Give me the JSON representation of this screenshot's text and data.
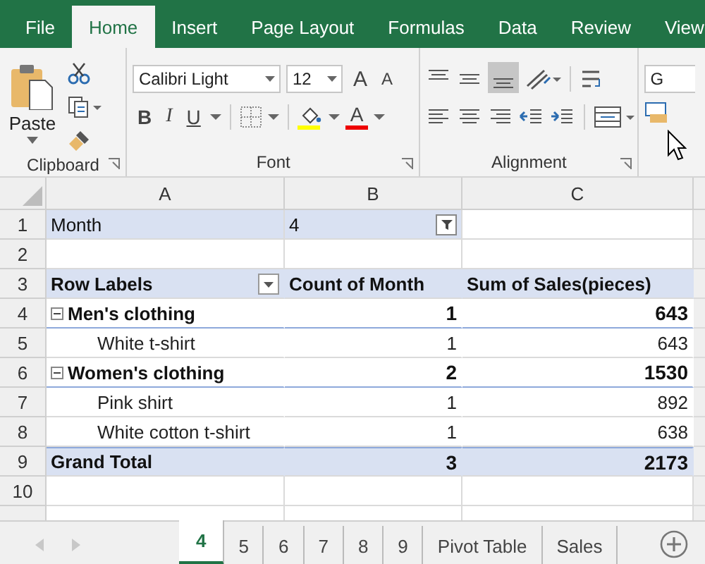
{
  "ribbon_tabs": [
    {
      "label": "File",
      "selected": false
    },
    {
      "label": "Home",
      "selected": true
    },
    {
      "label": "Insert",
      "selected": false
    },
    {
      "label": "Page Layout",
      "selected": false
    },
    {
      "label": "Formulas",
      "selected": false
    },
    {
      "label": "Data",
      "selected": false
    },
    {
      "label": "Review",
      "selected": false
    },
    {
      "label": "View",
      "selected": false
    }
  ],
  "clipboard": {
    "paste_label": "Paste",
    "group_label": "Clipboard"
  },
  "font": {
    "name": "Calibri Light",
    "size": "12",
    "bold": "B",
    "italic": "I",
    "underline": "U",
    "grow": "A",
    "shrink": "A",
    "color_letter": "A",
    "group_label": "Font"
  },
  "alignment": {
    "group_label": "Alignment"
  },
  "number": {
    "format": "G"
  },
  "columns": [
    "A",
    "B",
    "C"
  ],
  "rows": [
    {
      "number": "1",
      "kind": "filter",
      "label": "Month",
      "value": "4"
    },
    {
      "number": "2",
      "kind": "blank"
    },
    {
      "number": "3",
      "kind": "header",
      "cells": [
        "Row Labels",
        "Count of Month",
        "Sum of Sales(pieces)"
      ]
    },
    {
      "number": "4",
      "kind": "group",
      "label": "Men's clothing",
      "expanded": true,
      "count": "1",
      "sum": "643"
    },
    {
      "number": "5",
      "kind": "item",
      "label": "White t-shirt",
      "count": "1",
      "sum": "643"
    },
    {
      "number": "6",
      "kind": "group",
      "label": "Women's clothing",
      "expanded": true,
      "count": "2",
      "sum": "1530"
    },
    {
      "number": "7",
      "kind": "item",
      "label": "Pink shirt",
      "count": "1",
      "sum": "892"
    },
    {
      "number": "8",
      "kind": "item",
      "label": "White cotton t-shirt",
      "count": "1",
      "sum": "638"
    },
    {
      "number": "9",
      "kind": "total",
      "label": "Grand Total",
      "count": "3",
      "sum": "2173"
    },
    {
      "number": "10",
      "kind": "blank"
    }
  ],
  "sheet_tabs": [
    {
      "label": "4",
      "selected": true
    },
    {
      "label": "5",
      "selected": false
    },
    {
      "label": "6",
      "selected": false
    },
    {
      "label": "7",
      "selected": false
    },
    {
      "label": "8",
      "selected": false
    },
    {
      "label": "9",
      "selected": false
    },
    {
      "label": "Pivot Table",
      "selected": false
    },
    {
      "label": "Sales",
      "selected": false
    }
  ]
}
